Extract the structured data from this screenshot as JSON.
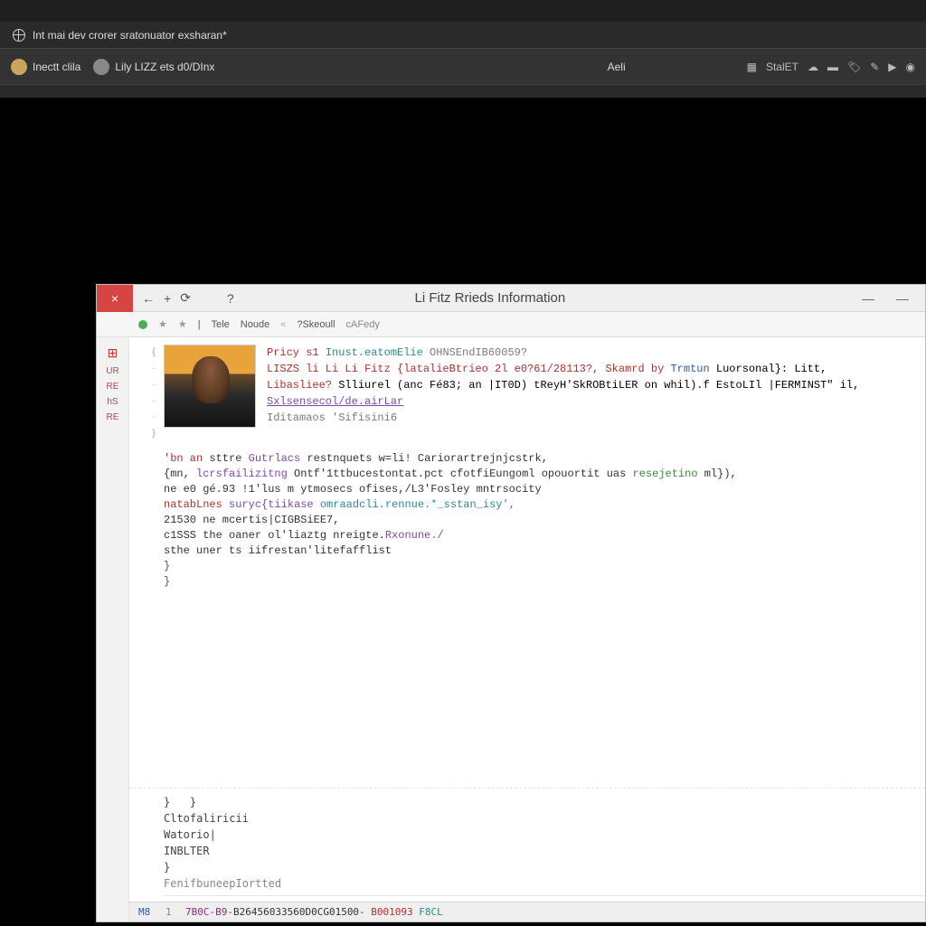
{
  "shell": {
    "path_text": "Int mai dev crorer sratonuator exsharan*",
    "menu": {
      "user1_label": "Inectt clila",
      "user2_label": "Lily  LIZZ ets d0/DInx",
      "center_label": "Aeli",
      "right_label": "StalET"
    }
  },
  "window": {
    "title": "Li Fitz Rrieds  Information",
    "toolbar": {
      "item1": "Tele",
      "item2": "Noude",
      "item3": "?Skeoull",
      "item4": "cAFedy"
    },
    "gutter": [
      "UR",
      "RE",
      "hS",
      "RE"
    ],
    "meta": {
      "l1a": "Pricy s1",
      "l1b": "Inust.eatomElie",
      "l1c": "OHNSEndIB60059?",
      "l2a": "LISZS li Li  Li  Fitz {latalieBtrieo 2l e0?61/28113?, Skamrd by",
      "l2b": "Trmtun",
      "l2c": " Luorsonal}: Litt,",
      "l3a": "Libasliee?",
      "l3b": "Slliurel (anc Fé83; an |IT0D) tReyH'SkROBtiLER on whil).f EstoLIl |FERMINST\"  il,",
      "l4": "Sxlsensecol/de.airLar",
      "l5a": "Iditamaos",
      "l5b": "'Sifisini6"
    },
    "code": {
      "l1a": "'bn an",
      "l1b": " sttre ",
      "l1c": "Gutrlacs",
      "l1d": " restnquets w=li! Cariorartrejnjcstrk,",
      "l2a": "{mn,",
      "l2b": "lcrsfailizitng",
      "l2c": " Ontf'1ttbucestontat.pct cfotfiEungoml opouortit  uas",
      "l2d": " resejetino",
      "l2e": " ml}),",
      "l3": "ne e0 gé.93 !1'lus m ytmosecs ofises,/L3'Fosley mntrsocity",
      "l4a": "natabLnes",
      "l4b": " suryc{tiikase",
      "l4c": " omraadcli.rennue.*_sstan_isy',",
      "l5a": "21530 ne mcertis|CIGBSiEE7,",
      "l6a": "c1SSS the oaner ol'liaztg nreigte.",
      "l6b": "Rxonune./",
      "l7": "sthe uner ts iifrestan'litefafflist"
    },
    "footer": {
      "f1": "Cltofaliricii",
      "f2": "Watorio|",
      "f3": "INBLTER",
      "f4": "FenifbuneepIortted"
    },
    "status": {
      "left1": "M8",
      "left2": "1",
      "hash_a": "7B0C-B9-",
      "hash_b": "B26456033560D0CG01500-",
      "hash_c": " B001093 ",
      "hash_d": " F8CL"
    },
    "controls": {
      "close": "×",
      "min": "—",
      "max": "—",
      "help": "?",
      "back": "←",
      "fwd": "→",
      "reload": "⟳"
    }
  }
}
